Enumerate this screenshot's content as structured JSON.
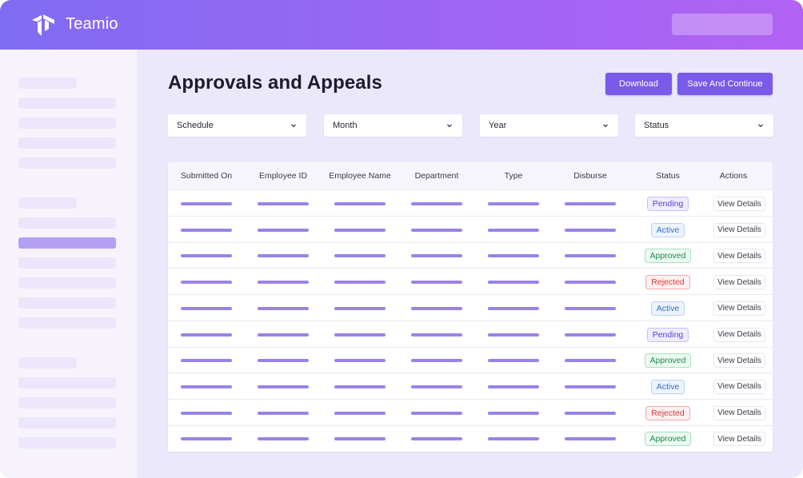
{
  "header": {
    "brand": "Teamio"
  },
  "page": {
    "title": "Approvals and Appeals"
  },
  "actions": {
    "download_label": "Download",
    "save_label": "Save And Continue"
  },
  "filters": [
    {
      "label": "Schedule"
    },
    {
      "label": "Month"
    },
    {
      "label": "Year"
    },
    {
      "label": "Status"
    }
  ],
  "table": {
    "columns": [
      "Submitted On",
      "Employee ID",
      "Employee Name",
      "Department",
      "Type",
      "Disburse",
      "Status",
      "Actions"
    ],
    "action_label": "View Details",
    "rows": [
      {
        "status": "Pending"
      },
      {
        "status": "Active"
      },
      {
        "status": "Approved"
      },
      {
        "status": "Rejected"
      },
      {
        "status": "Active"
      },
      {
        "status": "Pending"
      },
      {
        "status": "Approved"
      },
      {
        "status": "Active"
      },
      {
        "status": "Rejected"
      },
      {
        "status": "Approved"
      }
    ]
  },
  "status_colors": {
    "Pending": {
      "text": "#5b3fd9",
      "bg": "#f0ecff",
      "border": "#c9bdf7"
    },
    "Active": {
      "text": "#2a6fd6",
      "bg": "#edf4ff",
      "border": "#b9d2f6"
    },
    "Approved": {
      "text": "#1f8a4c",
      "bg": "#ecfaf1",
      "border": "#a9dfbf"
    },
    "Rejected": {
      "text": "#d13a3a",
      "bg": "#fff0f0",
      "border": "#f0a9a9"
    }
  },
  "colors": {
    "accent": "#7a5ae8",
    "header_gradient_start": "#7f6cf2",
    "header_gradient_end": "#b262f4",
    "placeholder_bar": "#9a82e9"
  },
  "icons": {
    "logo": "teamio-logo-icon",
    "dropdown": "chevron-down-icon"
  }
}
